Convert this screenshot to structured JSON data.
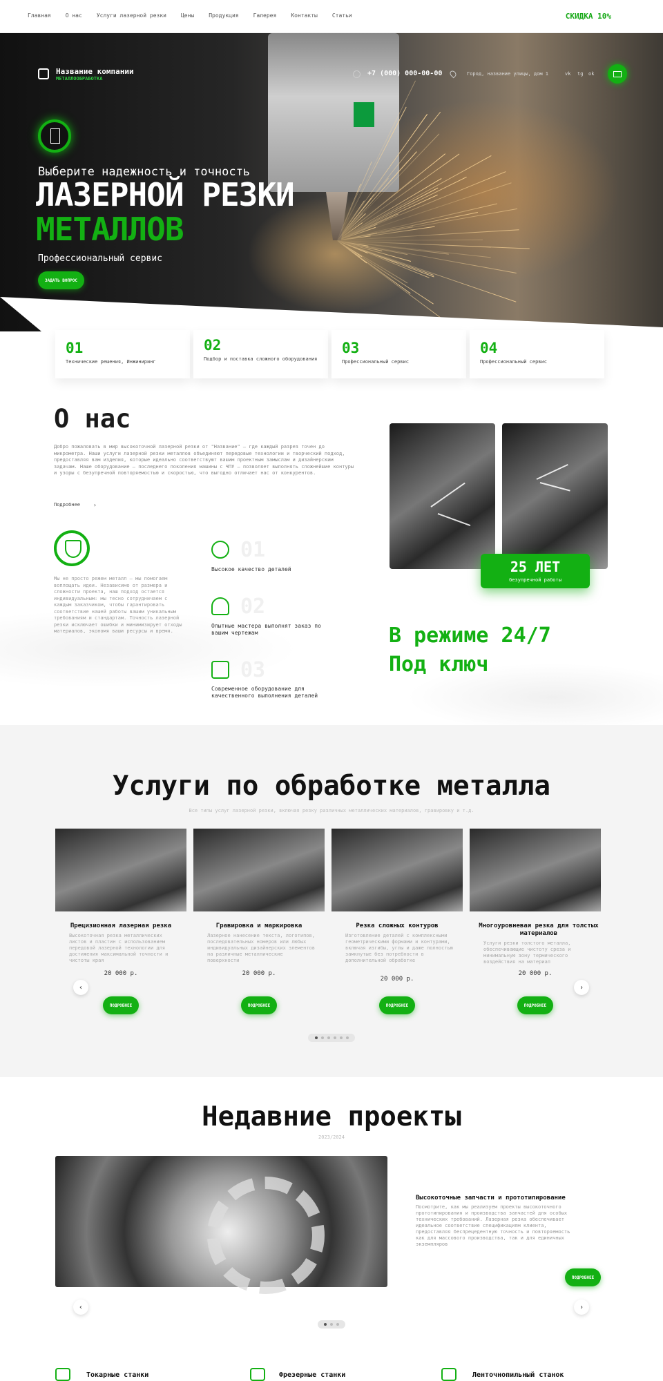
{
  "topnav": {
    "items": [
      "Главная",
      "О нас",
      "Услуги лазерной резки",
      "Цены",
      "Продукция",
      "Галерея",
      "Контакты",
      "Статьи"
    ],
    "discount": "СКИДКА 10%"
  },
  "header": {
    "company": "Название компании",
    "company_sub": "МЕТАЛЛООБРАБОТКА",
    "phone": "+7 (000) 000-00-00",
    "address": "Город, название улицы, дом 1",
    "social": [
      "vk",
      "tg",
      "ok"
    ]
  },
  "hero": {
    "pre": "Выберите надежность и точность",
    "title1": "ЛАЗЕРНОЙ РЕЗКИ",
    "title2": "МЕТАЛЛОВ",
    "sub": "Профессиональный сервис",
    "button": "ЗАДАТЬ ВОПРОС"
  },
  "features": [
    {
      "num": "01",
      "text": "Технические решения, Инжиниринг"
    },
    {
      "num": "02",
      "text": "Подбор и поставка сложного оборудования"
    },
    {
      "num": "03",
      "text": "Профессиональный сервис"
    },
    {
      "num": "04",
      "text": "Профессиональный сервис"
    }
  ],
  "about": {
    "title": "О нас",
    "text": "Добро пожаловать в мир высокоточной лазерной резки от \"Название\" — где каждый разрез точен до микрометра. Наши услуги лазерной резки металлов объединяют передовые технологии и творческий подход, предоставляя вам изделия, которые идеально соответствуют вашим проектным замыслам и дизайнерским задачам. Наше оборудование — последнего поколения машины с ЧПУ — позволяет выполнять сложнейшие контуры и узоры с безупречной повторяемостью и скоростью, что выгодно отличает нас от конкурентов.",
    "more": "Подробнее",
    "text2": "Мы не просто режем металл — мы помогаем воплощать идеи. Независимо от размера и сложности проекта, наш подход остается индивидуальным: мы тесно сотрудничаем с каждым заказчиком, чтобы гарантировать соответствие нашей работы вашим уникальным требованиям и стандартам. Точность лазерной резки исключает ошибки и минимизирует отходы материалов, экономя ваши ресурсы и время.",
    "years_big": "25 ЛЕТ",
    "years_small": "безупречной работы",
    "advantages": [
      {
        "num": "01",
        "icon": "gear-icon",
        "text": "Высокое качество деталей"
      },
      {
        "num": "02",
        "icon": "worker-icon",
        "text": "Опытные мастера выполнят заказ по вашим чертежам"
      },
      {
        "num": "03",
        "icon": "machine-icon",
        "text": "Современное оборудование для качественного выполнения деталей"
      }
    ],
    "slogan1": "В режиме 24/7",
    "slogan2": "Под ключ"
  },
  "services": {
    "title": "Услуги по обработке металла",
    "sub": "Все типы услуг лазерной резки, включая резку различных металлических материалов, гравировку и т.д.",
    "button": "ПОДРОБНЕЕ",
    "cards": [
      {
        "title": "Прецизионная лазерная резка",
        "desc": "Высокоточная резка металлических листов и пластин с использованием передовой лазерной технологии для достижения максимальной точности и чистоты края",
        "price": "20 000 р."
      },
      {
        "title": "Гравировка и маркировка",
        "desc": "Лазерное нанесение текста, логотипов, последовательных номеров или любых индивидуальных дизайнерских элементов на различные металлические поверхности",
        "price": "20 000 р."
      },
      {
        "title": "Резка сложных контуров",
        "desc": "Изготовление деталей с комплексными геометрическими формами и контурами, включая изгибы, углы и даже полностью замкнутые без потребности в дополнительной обработке",
        "price": "20 000 р."
      },
      {
        "title": "Многоуровневая резка для толстых материалов",
        "desc": "Услуги резки толстого металла, обеспечивающие чистоту среза и минимальную зону термического воздействия на материал",
        "price": "20 000 р."
      }
    ]
  },
  "projects": {
    "title": "Недавние проекты",
    "sub": "2023/2024",
    "item_title": "Высокоточные запчасти и прототипирование",
    "item_desc": "Посмотрите, как мы реализуем проекты высокоточного прототипирования и производства запчастей для особых технических требований. Лазерная резка обеспечивает идеальное соответствие спецификациям клиента, предоставляя беспрецедентную точность и повторяемость как для массового производства, так и для единичных экземпляров",
    "button": "ПОДРОБНЕЕ"
  },
  "machines": [
    "Токарные станки",
    "Фрезерные станки",
    "Ленточнопильный станок"
  ],
  "colors": {
    "accent": "#13b013",
    "dark": "#111111"
  }
}
